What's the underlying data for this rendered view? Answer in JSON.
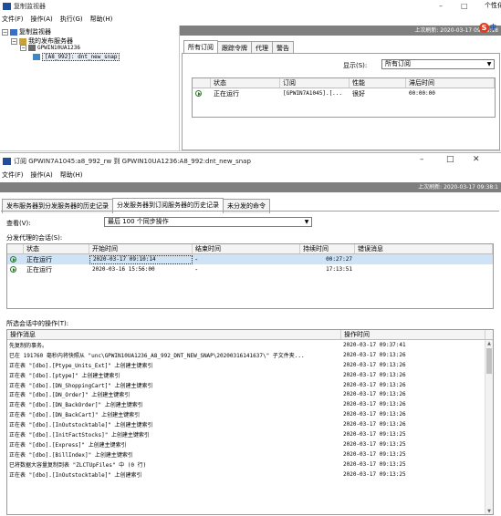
{
  "back_window": {
    "title": "复制监视器",
    "cut_label": "个性化",
    "window_controls": {
      "minimize": "–",
      "maximize": "□"
    },
    "menu": [
      "文件(F)",
      "操作(A)",
      "执行(G)",
      "帮助(H)"
    ],
    "tree": {
      "root": "复制监视器",
      "publishers": "我的发布服务器",
      "server": "GPWIN10UA1236",
      "publication": "[A8_992]: dnt_new_snap"
    },
    "last_refresh": "上次刷新: 2020-03-17 09:38:18",
    "tabs": [
      "所有订阅",
      "跟踪令牌",
      "代理",
      "警告"
    ],
    "show_label": "显示(S):",
    "show_value": "所有订阅",
    "grid": {
      "columns": [
        "",
        "状态",
        "订阅",
        "性能",
        "滞后时间"
      ],
      "rows": [
        {
          "status": "正在运行",
          "subscription": "[GPWIN7A1045].[...",
          "performance": "很好",
          "latency": "00:00:00"
        }
      ]
    }
  },
  "front_window": {
    "title": "订阅 GPWIN7A1045:a8_992_rw 到 GPWIN10UA1236:A8_992:dnt_new_snap",
    "window_controls": {
      "minimize": "–",
      "maximize": "□",
      "close": "✕"
    },
    "menu": [
      "文件(F)",
      "操作(A)",
      "帮助(H)"
    ],
    "last_refresh": "上次刷新: 2020-03-17 09:38:1",
    "tabs": [
      "发布服务器到分发服务器的历史记录",
      "分发服务器到订阅服务器的历史记录",
      "未分发的命令"
    ],
    "view_label": "查看(V):",
    "view_value": "最后 100 个同步操作",
    "sessions_label": "分发代理的会话(S):",
    "sessions": {
      "columns": [
        "",
        "状态",
        "开始时间",
        "结束时间",
        "持续时间",
        "错误消息"
      ],
      "rows": [
        {
          "status": "正在运行",
          "start": "2020-03-17 09:10:14",
          "end": "-",
          "duration": "00:27:27",
          "error": ""
        },
        {
          "status": "正在运行",
          "start": "2020-03-16 15:56:00",
          "end": "-",
          "duration": "17:13:51",
          "error": ""
        }
      ]
    },
    "actions_label": "所选会话中的操作(T):",
    "actions": {
      "columns": [
        "操作消息",
        "操作时间"
      ],
      "rows": [
        {
          "msg": "先复制的事务。",
          "time": "2020-03-17 09:37:41"
        },
        {
          "msg": "已在 191760 毫秒内将快照从 \"unc\\GPWIN10UA1236_A8_992_DNT_NEW_SNAP\\20200316141637\\\" 子文件夹...",
          "time": "2020-03-17 09:13:26"
        },
        {
          "msg": "正在表 \"[dbo].[Ptype_Units_Ext]\" 上创建主键索引",
          "time": "2020-03-17 09:13:26"
        },
        {
          "msg": "正在表 \"[dbo].[ptype]\" 上创建主键索引",
          "time": "2020-03-17 09:13:26"
        },
        {
          "msg": "正在表 \"[dbo].[DN_ShoppingCart]\" 上创建主键索引",
          "time": "2020-03-17 09:13:26"
        },
        {
          "msg": "正在表 \"[dbo].[DN_Order]\" 上创建主键索引",
          "time": "2020-03-17 09:13:26"
        },
        {
          "msg": "正在表 \"[dbo].[DN_BackOrder]\" 上创建主键索引",
          "time": "2020-03-17 09:13:26"
        },
        {
          "msg": "正在表 \"[dbo].[DN_BackCart]\" 上创建主键索引",
          "time": "2020-03-17 09:13:26"
        },
        {
          "msg": "正在表 \"[dbo].[InOutstocktable]\" 上创建主键索引",
          "time": "2020-03-17 09:13:26"
        },
        {
          "msg": "正在表 \"[dbo].[InitFactStocks]\" 上创建主键索引",
          "time": "2020-03-17 09:13:25"
        },
        {
          "msg": "正在表 \"[dbo].[Express]\" 上创建主键索引",
          "time": "2020-03-17 09:13:25"
        },
        {
          "msg": "正在表 \"[dbo].[BillIndex]\" 上创建主键索引",
          "time": "2020-03-17 09:13:25"
        },
        {
          "msg": "已将数据大容量复制到表 \"ZLCTUpFiles\" 中 (0 行)",
          "time": "2020-03-17 09:13:25"
        },
        {
          "msg": "正在表 \"[dbo].[InOutstocktable]\" 上创建索引",
          "time": "2020-03-17 09:13:25"
        }
      ]
    }
  },
  "colors": {
    "accent_bar": "#7f7f7f",
    "selection": "#cfe3f7",
    "running_green": "#2c7a2c",
    "logo_red": "#e53a1c"
  }
}
